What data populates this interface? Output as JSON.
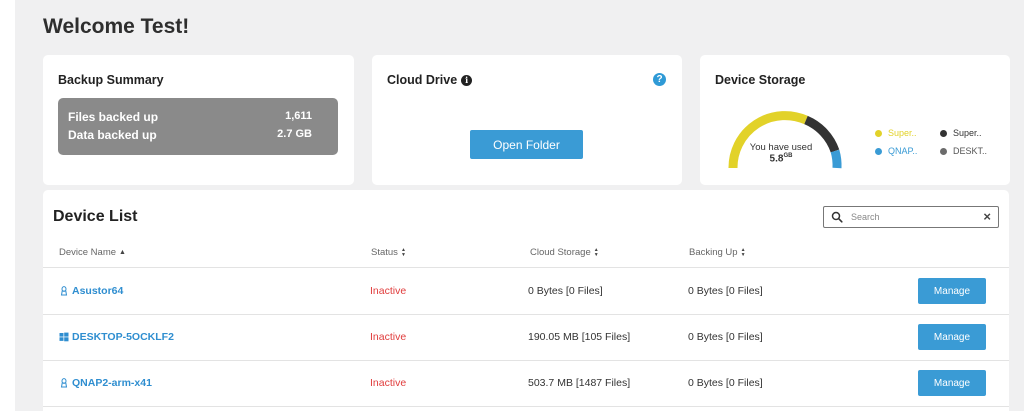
{
  "welcome": "Welcome Test!",
  "backup_summary": {
    "title": "Backup Summary",
    "rows": [
      {
        "label": "Files backed up",
        "value": "1,611"
      },
      {
        "label": "Data backed up",
        "value": "2.7 GB"
      }
    ]
  },
  "cloud_drive": {
    "title": "Cloud Drive",
    "info_icon": "info-icon",
    "help_icon": "help-icon",
    "button_label": "Open Folder"
  },
  "device_storage": {
    "title": "Device Storage",
    "used_label": "You have used",
    "used_value": "5.8",
    "used_unit": "GB",
    "legend": [
      {
        "label": "Super..",
        "color": "#e2d229"
      },
      {
        "label": "Super..",
        "color": "#333333"
      },
      {
        "label": "QNAP..",
        "color": "#3a9bd5"
      },
      {
        "label": "DESKT..",
        "color": "#6b6b6b"
      }
    ]
  },
  "device_list": {
    "title": "Device List",
    "search_placeholder": "Search",
    "columns": [
      "Device Name",
      "Status",
      "Cloud Storage",
      "Backing Up"
    ],
    "manage_label": "Manage",
    "devices": [
      {
        "name": "Asustor64",
        "os_icon": "linux-icon",
        "status": "Inactive",
        "cloud_storage": "0 Bytes [0 Files]",
        "backing_up": "0 Bytes [0 Files]"
      },
      {
        "name": "DESKTOP-5OCKLF2",
        "os_icon": "windows-icon",
        "status": "Inactive",
        "cloud_storage": "190.05 MB [105 Files]",
        "backing_up": "0 Bytes [0 Files]"
      },
      {
        "name": "QNAP2-arm-x41",
        "os_icon": "linux-icon",
        "status": "Inactive",
        "cloud_storage": "503.7 MB [1487 Files]",
        "backing_up": "0 Bytes [0 Files]"
      }
    ]
  },
  "colors": {
    "accent": "#3a9bd5",
    "inactive": "#e03c3c",
    "gauge_yellow": "#e2d229",
    "gauge_dark": "#333333",
    "gauge_blue": "#3a9bd5"
  }
}
